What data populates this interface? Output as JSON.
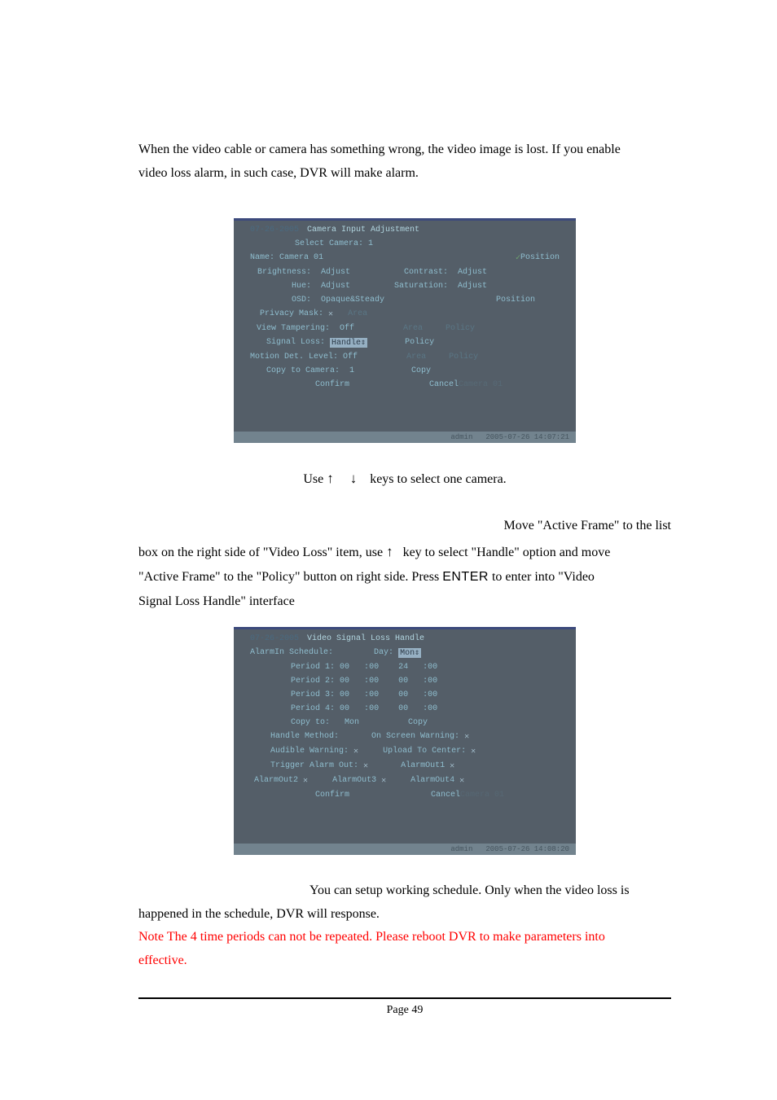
{
  "intro": {
    "line1": "When the video cable or camera has something wrong, the video image is lost. If you enable",
    "line2": "video loss alarm, in such case, DVR will make alarm."
  },
  "dvr1": {
    "date_prefix": "07-26-2005",
    "title": "Camera Input Adjustment",
    "select_camera_label": "Select Camera: 1",
    "name_label": "Name:",
    "name_value": "Camera 01",
    "position_label": "Position",
    "brightness_label": "Brightness:",
    "brightness_value": "Adjust",
    "contrast_label": "Contrast:",
    "contrast_value": "Adjust",
    "hue_label": "Hue:",
    "hue_value": "Adjust",
    "saturation_label": "Saturation:",
    "saturation_value": "Adjust",
    "osd_label": "OSD:",
    "osd_value": "Opaque&Steady",
    "osd_position": "Position",
    "privacy_mask_label": "Privacy Mask:",
    "privacy_mask_area": "Area",
    "view_tampering_label": "View Tampering:",
    "view_tampering_value": "Off",
    "vt_area": "Area",
    "vt_policy": "Policy",
    "signal_loss_label": "Signal Loss:",
    "signal_loss_value": "Handle",
    "signal_loss_policy": "Policy",
    "motion_label": "Motion Det. Level:",
    "motion_value": "Off",
    "motion_area": "Area",
    "motion_policy": "Policy",
    "copy_to_label": "Copy to Camera:",
    "copy_to_value": "1",
    "copy_btn": "Copy",
    "confirm_btn": "Confirm",
    "cancel_btn": "Cancel",
    "watermark": "Camera 01",
    "status_user": "admin",
    "status_time": "2005-07-26 14:07:21"
  },
  "step1": {
    "prefix": "Use ",
    "suffix": " keys to select one camera."
  },
  "step2": {
    "lead": "Move \"Active Frame\" to the list",
    "line2": "box on the right side of \"Video Loss\" item, use ",
    "line2b": " key to select \"Handle\" option and move",
    "line3": "\"Active Frame\" to the \"Policy\" button on right side. Press ",
    "enter": "ENTER",
    "line3b": " to enter into \"Video",
    "line4": "Signal Loss Handle\" interface"
  },
  "dvr2": {
    "date_prefix": "07-26-2005",
    "title": "Video Signal Loss Handle",
    "alarmin_label": "AlarmIn Schedule:",
    "day_label": "Day:",
    "day_value": "Mon",
    "periods": [
      {
        "label": "Period 1:",
        "h1": "00",
        "m1": "00",
        "h2": "24",
        "m2": "00"
      },
      {
        "label": "Period 2:",
        "h1": "00",
        "m1": "00",
        "h2": "00",
        "m2": "00"
      },
      {
        "label": "Period 3:",
        "h1": "00",
        "m1": "00",
        "h2": "00",
        "m2": "00"
      },
      {
        "label": "Period 4:",
        "h1": "00",
        "m1": "00",
        "h2": "00",
        "m2": "00"
      }
    ],
    "copy_to_label": "Copy to:",
    "copy_to_value": "Mon",
    "copy_btn": "Copy",
    "handle_method_label": "Handle Method:",
    "onscreen_label": "On Screen Warning:",
    "audible_label": "Audible Warning:",
    "upload_label": "Upload To Center:",
    "trigger_label": "Trigger Alarm Out:",
    "alarmout1": "AlarmOut1",
    "alarmout2": "AlarmOut2",
    "alarmout3": "AlarmOut3",
    "alarmout4": "AlarmOut4",
    "confirm_btn": "Confirm",
    "cancel_btn": "Cancel",
    "watermark": "Camera 01",
    "status_user": "admin",
    "status_time": "2005-07-26 14:08:20"
  },
  "step3": {
    "lead": "You can setup working schedule. Only when the video loss is",
    "line2": "happened in the schedule, DVR will response."
  },
  "note": {
    "line1": "Note  The 4 time periods can not be repeated. Please reboot DVR to make parameters into",
    "line2": "effective."
  },
  "footer": {
    "page": "Page 49"
  }
}
